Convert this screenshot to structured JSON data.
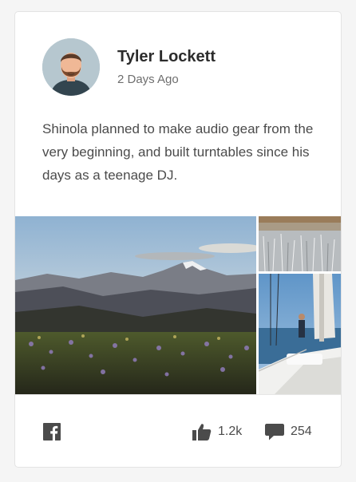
{
  "post": {
    "author": {
      "name": "Tyler Lockett",
      "avatar_icon": "person-avatar-icon"
    },
    "timestamp": "2 Days Ago",
    "body": "Shinola planned to make audio gear from the very beginning, and built turntables since his days as a teenage DJ.",
    "images": [
      {
        "subject": "mountain-wildflower-meadow"
      },
      {
        "subject": "frosted-field"
      },
      {
        "subject": "sailboat-deck"
      }
    ]
  },
  "actions": {
    "share_icon": "facebook-icon",
    "like_icon": "thumbs-up-icon",
    "like_count": "1.2k",
    "comment_icon": "comment-icon",
    "comment_count": "254"
  },
  "colors": {
    "text_primary": "#2c2c2c",
    "text_secondary": "#6e6e6e",
    "icon": "#4b4b4b",
    "avatar_bg": "#b6c7cf"
  }
}
